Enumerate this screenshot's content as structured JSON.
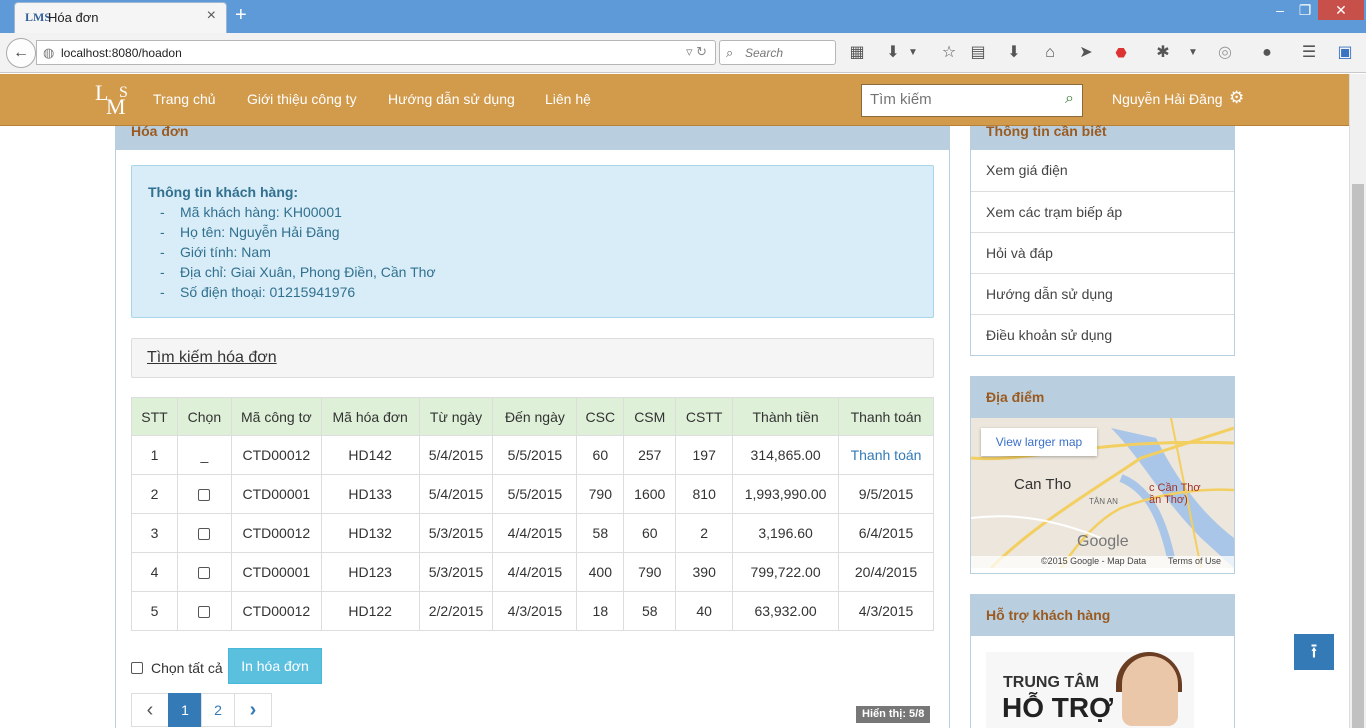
{
  "browser": {
    "tab_title": "Hóa đơn",
    "tab_favicon": "LMS",
    "url": "localhost:8080/hoadon",
    "search_placeholder": "Search"
  },
  "site": {
    "logo": {
      "l1": "L",
      "l2": "M",
      "l3": "S"
    },
    "nav": [
      "Trang chủ",
      "Giới thiệu công ty",
      "Hướng dẫn sử dụng",
      "Liên hệ"
    ],
    "search_placeholder": "Tìm kiếm",
    "user_name": "Nguyễn Hải Đăng"
  },
  "main": {
    "title": "Hóa đơn",
    "customer": {
      "heading": "Thông tin khách hàng:",
      "lines": [
        "Mã khách hàng: KH00001",
        "Họ tên: Nguyễn Hải Đăng",
        "Giới tính: Nam",
        "Địa chỉ: Giai Xuân, Phong Điền, Cần Thơ",
        "Số điện thoại: 01215941976"
      ]
    },
    "search_invoice": "Tìm kiếm hóa đơn",
    "table": {
      "headers": [
        "STT",
        "Chọn",
        "Mã công tơ",
        "Mã hóa đơn",
        "Từ ngày",
        "Đến ngày",
        "CSC",
        "CSM",
        "CSTT",
        "Thành tiền",
        "Thanh toán"
      ],
      "rows": [
        {
          "stt": "1",
          "choose": "_",
          "meter": "CTD00012",
          "invoice": "HD142",
          "from": "5/4/2015",
          "to": "5/5/2015",
          "csc": "60",
          "csm": "257",
          "cstt": "197",
          "amount": "314,865.00",
          "pay": "Thanh toán"
        },
        {
          "stt": "2",
          "choose": "checkbox",
          "meter": "CTD00001",
          "invoice": "HD133",
          "from": "5/4/2015",
          "to": "5/5/2015",
          "csc": "790",
          "csm": "1600",
          "cstt": "810",
          "amount": "1,993,990.00",
          "pay": "9/5/2015"
        },
        {
          "stt": "3",
          "choose": "checkbox",
          "meter": "CTD00012",
          "invoice": "HD132",
          "from": "5/3/2015",
          "to": "4/4/2015",
          "csc": "58",
          "csm": "60",
          "cstt": "2",
          "amount": "3,196.60",
          "pay": "6/4/2015"
        },
        {
          "stt": "4",
          "choose": "checkbox",
          "meter": "CTD00001",
          "invoice": "HD123",
          "from": "5/3/2015",
          "to": "4/4/2015",
          "csc": "400",
          "csm": "790",
          "cstt": "390",
          "amount": "799,722.00",
          "pay": "20/4/2015"
        },
        {
          "stt": "5",
          "choose": "checkbox",
          "meter": "CTD00012",
          "invoice": "HD122",
          "from": "2/2/2015",
          "to": "4/3/2015",
          "csc": "18",
          "csm": "58",
          "cstt": "40",
          "amount": "63,932.00",
          "pay": "4/3/2015"
        }
      ]
    },
    "select_all": "Chọn tất cả",
    "print_button": "In hóa đơn",
    "pager": {
      "prev": "‹",
      "pages": [
        "1",
        "2"
      ],
      "next": "›",
      "active": "1"
    },
    "showing": "Hiển thị: 5/8"
  },
  "sidebar": {
    "info_title": "Thông tin cần biết",
    "info_items": [
      "Xem giá điện",
      "Xem các trạm biếp áp",
      "Hỏi và đáp",
      "Hướng dẫn sử dụng",
      "Điều khoản sử dụng"
    ],
    "map_title": "Địa điểm",
    "map": {
      "button": "View larger map",
      "city": "Can Tho",
      "pin_line1": "c Cần Thơ",
      "pin_line2": "ần Thơ)",
      "district": "TÂN AN",
      "google": "Google",
      "copyright": "©2015 Google - Map Data",
      "terms": "Terms of Use"
    },
    "support_title": "Hỗ trợ khách hàng",
    "support_banner": {
      "line1": "TRUNG TÂM",
      "line2": "HỖ TRỢ"
    }
  },
  "colors": {
    "header_bg": "#d29a4b",
    "panel_head": "#b9cfe0",
    "info_bg": "#d8edf7",
    "table_head": "#dff0d8",
    "primary": "#337ab7",
    "print_btn": "#5bc0de"
  }
}
